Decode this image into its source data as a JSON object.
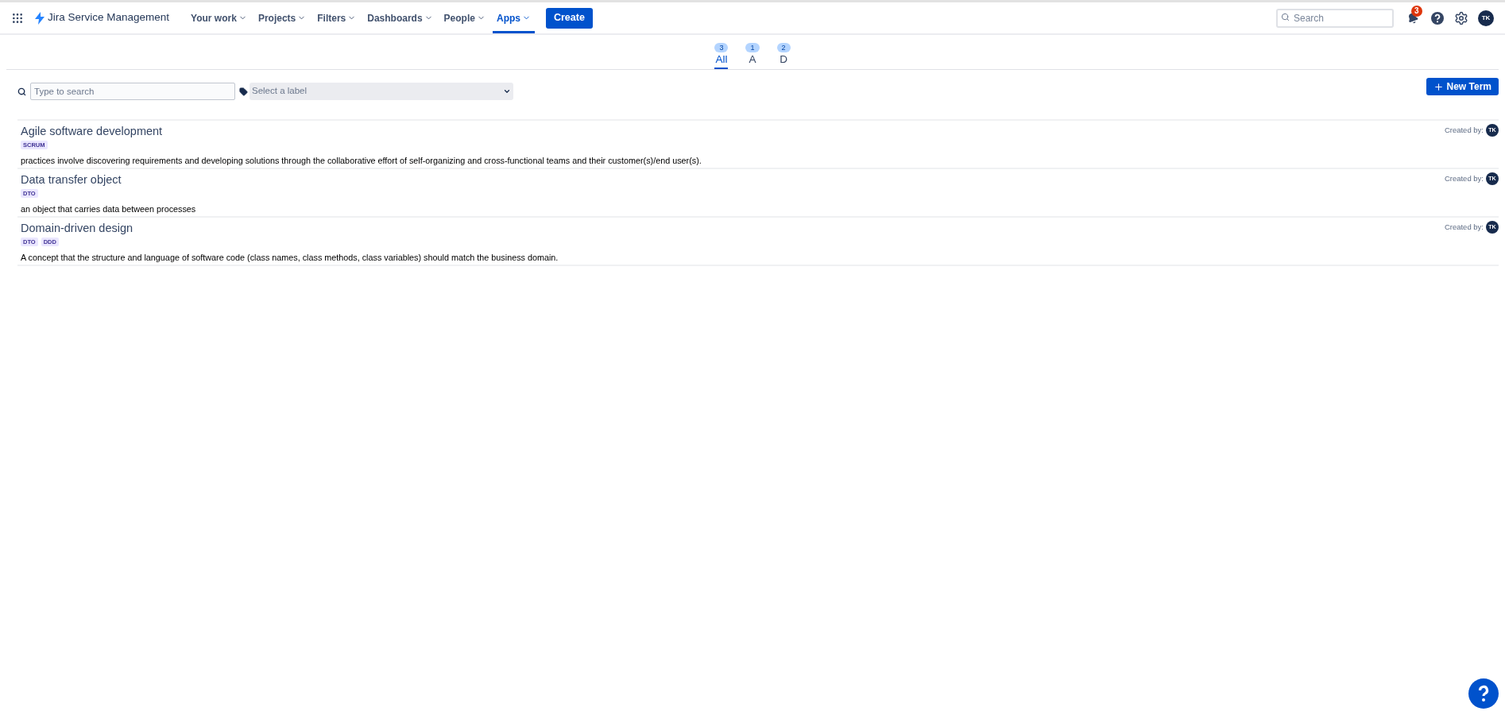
{
  "header": {
    "product": "Jira Service Management",
    "nav": [
      {
        "label": "Your work",
        "selected": false
      },
      {
        "label": "Projects",
        "selected": false
      },
      {
        "label": "Filters",
        "selected": false
      },
      {
        "label": "Dashboards",
        "selected": false
      },
      {
        "label": "People",
        "selected": false
      },
      {
        "label": "Apps",
        "selected": true
      }
    ],
    "create": "Create",
    "search": {
      "placeholder": "Search"
    },
    "notifications": "3",
    "avatar": "TK"
  },
  "tabs": [
    {
      "label": "All",
      "count": "3",
      "selected": true
    },
    {
      "label": "A",
      "count": "1",
      "selected": false
    },
    {
      "label": "D",
      "count": "2",
      "selected": false
    }
  ],
  "filters": {
    "search": {
      "placeholder": "Type to search"
    },
    "label": {
      "placeholder": "Select a label"
    }
  },
  "new_term": "New Term",
  "terms": [
    {
      "title": "Agile software development",
      "tags": [
        "SCRUM"
      ],
      "description": "practices involve discovering requirements and developing solutions through the collaborative effort of self-organizing and cross-functional teams and their customer(s)/end user(s).",
      "created_by": "Created by:",
      "author": "TK"
    },
    {
      "title": "Data transfer object",
      "tags": [
        "DTO"
      ],
      "description": "an object that carries data between processes",
      "created_by": "Created by:",
      "author": "TK"
    },
    {
      "title": "Domain-driven design",
      "tags": [
        "DTO",
        "DDD"
      ],
      "description": "A concept that the structure and language of software code (class names, class methods, class variables) should match the business domain.",
      "created_by": "Created by:",
      "author": "TK"
    }
  ]
}
